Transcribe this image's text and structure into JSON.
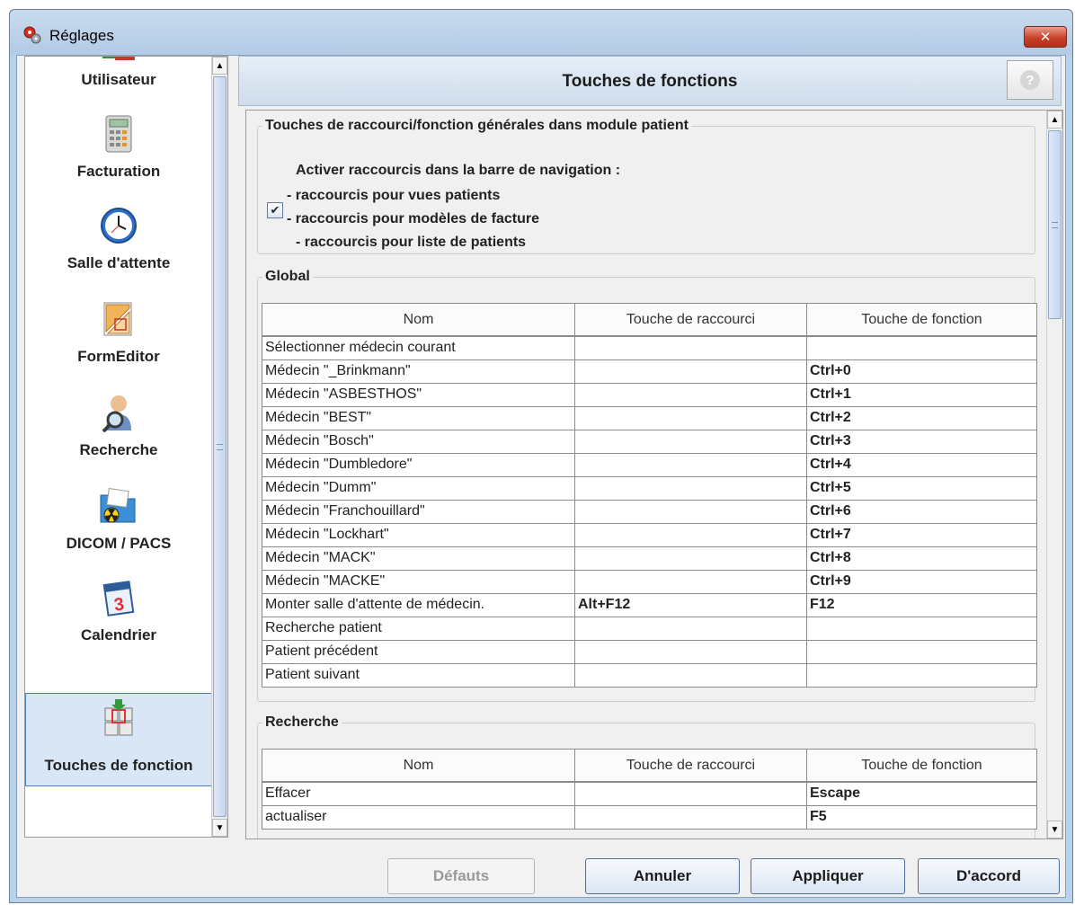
{
  "window": {
    "title": "Réglages",
    "close_glyph": "✕"
  },
  "sidebar": {
    "items": [
      {
        "label": "Utilisateur",
        "icon": "users-icon"
      },
      {
        "label": "Facturation",
        "icon": "calculator-icon"
      },
      {
        "label": "Salle d'attente",
        "icon": "clock-icon"
      },
      {
        "label": "FormEditor",
        "icon": "form-editor-icon"
      },
      {
        "label": "Recherche",
        "icon": "search-person-icon"
      },
      {
        "label": "DICOM / PACS",
        "icon": "folder-radiation-icon"
      },
      {
        "label": "Calendrier",
        "icon": "calendar-icon"
      },
      {
        "label": "Touches de fonction",
        "icon": "keyboard-keys-icon",
        "selected": true
      }
    ],
    "scroll_up": "▲",
    "scroll_down": "▼"
  },
  "panel": {
    "title": "Touches de fonctions",
    "help_glyph": "?"
  },
  "general": {
    "legend": "Touches de raccourci/fonction générales dans module patient",
    "heading": "Activer raccourcis dans la barre de navigation :",
    "checked": true,
    "check_glyph": "✔",
    "lines": [
      "- raccourcis pour vues patients",
      "- raccourcis pour modèles de facture",
      "- raccourcis pour liste de patients"
    ]
  },
  "global": {
    "legend": "Global",
    "columns": [
      "Nom",
      "Touche de raccourci",
      "Touche de fonction"
    ],
    "rows": [
      [
        "Sélectionner médecin courant",
        "",
        ""
      ],
      [
        "Médecin \"_Brinkmann\"",
        "",
        "Ctrl+0"
      ],
      [
        "Médecin \"ASBESTHOS\"",
        "",
        "Ctrl+1"
      ],
      [
        "Médecin \"BEST\"",
        "",
        "Ctrl+2"
      ],
      [
        "Médecin \"Bosch\"",
        "",
        "Ctrl+3"
      ],
      [
        "Médecin \"Dumbledore\"",
        "",
        "Ctrl+4"
      ],
      [
        "Médecin \"Dumm\"",
        "",
        "Ctrl+5"
      ],
      [
        "Médecin \"Franchouillard\"",
        "",
        "Ctrl+6"
      ],
      [
        "Médecin \"Lockhart\"",
        "",
        "Ctrl+7"
      ],
      [
        "Médecin \"MACK\"",
        "",
        "Ctrl+8"
      ],
      [
        "Médecin \"MACKE\"",
        "",
        "Ctrl+9"
      ],
      [
        "Monter salle d'attente de médecin.",
        "Alt+F12",
        "F12"
      ],
      [
        "Recherche patient",
        "",
        ""
      ],
      [
        "Patient précédent",
        "",
        ""
      ],
      [
        "Patient suivant",
        "",
        ""
      ]
    ]
  },
  "recherche": {
    "legend": "Recherche",
    "columns": [
      "Nom",
      "Touche de raccourci",
      "Touche de fonction"
    ],
    "rows": [
      [
        "Effacer",
        "",
        "Escape"
      ],
      [
        "actualiser",
        "",
        "F5"
      ]
    ]
  },
  "buttons": {
    "defaults": "Défauts",
    "cancel": "Annuler",
    "apply": "Appliquer",
    "ok": "D'accord"
  }
}
